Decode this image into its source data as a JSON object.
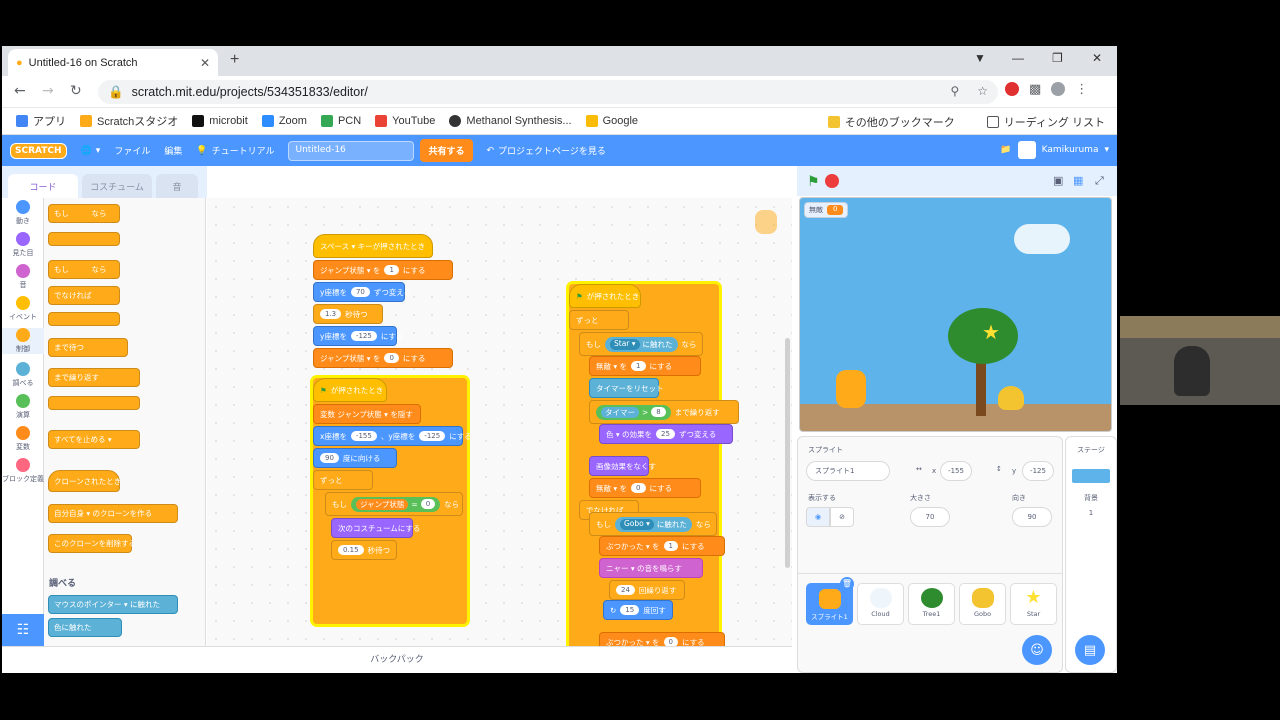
{
  "browser": {
    "tab_title": "Untitled-16 on Scratch",
    "url": "scratch.mit.edu/projects/534351833/editor/",
    "bookmarks": [
      "アプリ",
      "Scratchスタジオ",
      "microbit",
      "Zoom",
      "PCN",
      "YouTube",
      "Methanol Synthesis...",
      "Google"
    ],
    "other_bookmarks": "その他のブックマーク",
    "reading_list": "リーディング リスト"
  },
  "menu": {
    "logo": "SCRATCH",
    "file": "ファイル",
    "edit": "編集",
    "tutorial": "チュートリアル",
    "project_title": "Untitled-16",
    "share": "共有する",
    "project_page": "プロジェクトページを見る",
    "username": "Kamikuruma"
  },
  "editor_tabs": {
    "code": "コード",
    "costumes": "コスチューム",
    "sounds": "音"
  },
  "categories": [
    {
      "label": "動き",
      "color": "#4c97ff"
    },
    {
      "label": "見た目",
      "color": "#9966ff"
    },
    {
      "label": "音",
      "color": "#cf63cf"
    },
    {
      "label": "イベント",
      "color": "#ffbf00"
    },
    {
      "label": "制御",
      "color": "#ffab19"
    },
    {
      "label": "調べる",
      "color": "#5cb1d6"
    },
    {
      "label": "演算",
      "color": "#59c059"
    },
    {
      "label": "変数",
      "color": "#ff8c1a"
    },
    {
      "label": "ブロック定義",
      "color": "#ff6680"
    }
  ],
  "palette": {
    "if_then": "もし　　　なら",
    "if_else": "もし　　　なら",
    "else": "でなければ",
    "wait_until": "まで待つ",
    "repeat_until": "まで繰り返す",
    "stop_all": "すべてを止める ▾",
    "when_clone": "クローンされたとき",
    "create_clone": "自分自身 ▾ のクローンを作る",
    "delete_clone": "このクローンを削除する",
    "sensing_header": "調べる",
    "touching_mouse": "マウスのポインター ▾ に触れた",
    "touching_color": "色に触れた"
  },
  "script1": {
    "hat": "スペース ▾ キーが押されたとき",
    "b1": "ジャンプ状態 ▾ を",
    "b1v": "1",
    "b1s": "にする",
    "b2": "y座標を",
    "b2v": "70",
    "b2s": "ずつ変える",
    "b3v": "1.3",
    "b3s": "秒待つ",
    "b4": "y座標を",
    "b4v": "-125",
    "b4s": "にする",
    "b5": "ジャンプ状態 ▾ を",
    "b5v": "0",
    "b5s": "にする"
  },
  "script2": {
    "hat": "が押されたとき",
    "b1": "変数 ジャンプ状態 ▾ を隠す",
    "b2": "x座標を",
    "b2v": "-155",
    "b2m": "、y座標を",
    "b2w": "-125",
    "b2s": "にする",
    "b3v": "90",
    "b3s": "度に向ける",
    "forever": "ずっと",
    "if": "もし",
    "cond": "ジャンプ状態",
    "eq": "=",
    "condv": "0",
    "then": "なら",
    "b4": "次のコスチュームにする",
    "b5v": "0.15",
    "b5s": "秒待つ"
  },
  "script3": {
    "hat": "が押されたとき",
    "forever": "ずっと",
    "if1": "もし",
    "touch1": "Star ▾",
    "touch1s": "に触れた",
    "then": "なら",
    "b1": "無敵 ▾ を",
    "b1v": "1",
    "b1s": "にする",
    "b2": "タイマーをリセット",
    "until": "タイマー",
    "gt": ">",
    "untilv": "8",
    "until_s": "まで繰り返す",
    "b3": "色 ▾ の効果を",
    "b3v": "25",
    "b3s": "ずつ変える",
    "b4": "画像効果をなくす",
    "b5": "無敵 ▾ を",
    "b5v": "0",
    "b5s": "にする",
    "else": "でなければ",
    "if2": "もし",
    "touch2": "Gobo ▾",
    "touch2s": "に触れた",
    "b6": "ぶつかった ▾ を",
    "b6v": "1",
    "b6s": "にする",
    "b7": "ニャー ▾ の音を鳴らす",
    "b8v": "24",
    "b8s": "回繰り返す",
    "b9v": "15",
    "b9s": "度回す",
    "b10": "ぶつかった ▾ を",
    "b10v": "0",
    "b10s": "にする"
  },
  "backpack": "バックパック",
  "stage": {
    "var_name": "無敵",
    "var_value": "0"
  },
  "sprite_info": {
    "sprite_label": "スプライト",
    "sprite_name": "スプライト1",
    "x_label": "x",
    "x": "-155",
    "y_label": "y",
    "y": "-125",
    "show_label": "表示する",
    "size_label": "大きさ",
    "size": "70",
    "direction_label": "向き",
    "direction": "90"
  },
  "sprites": [
    "スプライト1",
    "Cloud",
    "Tree1",
    "Gobo",
    "Star"
  ],
  "stage_pane": {
    "title": "ステージ",
    "backdrops_label": "背景",
    "backdrops": "1"
  }
}
